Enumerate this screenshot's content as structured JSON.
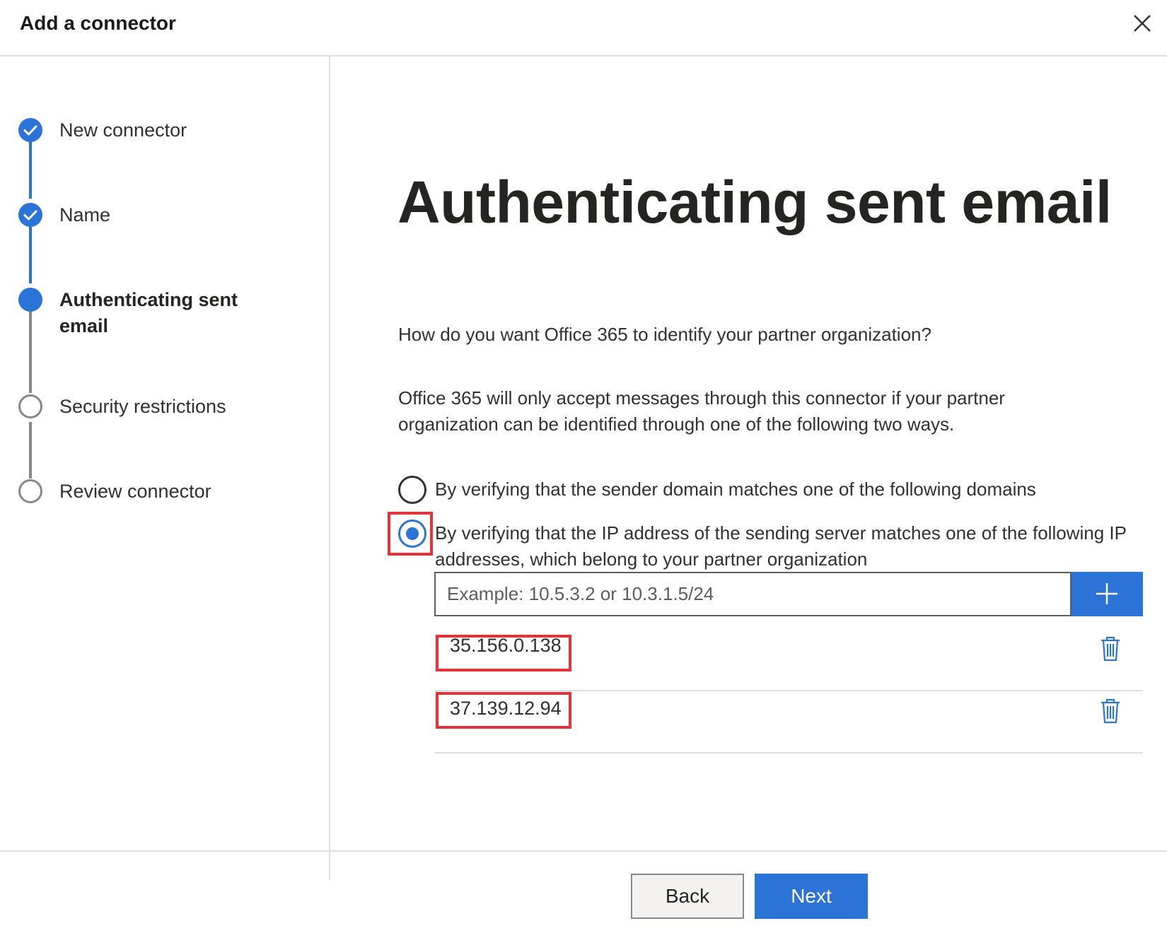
{
  "header": {
    "title": "Add a connector",
    "close_icon": "close-icon"
  },
  "steps": [
    {
      "label": "New connector",
      "state": "completed",
      "icon": "checkmark-icon"
    },
    {
      "label": "Name",
      "state": "completed",
      "icon": "checkmark-icon"
    },
    {
      "label": "Authenticating sent email",
      "state": "current"
    },
    {
      "label": "Security restrictions",
      "state": "pending"
    },
    {
      "label": "Review connector",
      "state": "pending"
    }
  ],
  "main": {
    "title": "Authenticating sent email",
    "question": "How do you want Office 365 to identify your partner organization?",
    "info": "Office 365 will only accept messages through this connector if your partner organization can be identified through one of the following two ways.",
    "options": [
      {
        "label": "By verifying that the sender domain matches one of the following domains",
        "selected": false
      },
      {
        "label": "By verifying that the IP address of the sending server matches one of the following IP addresses, which belong to your partner organization",
        "selected": true
      }
    ],
    "ip_input": {
      "value": "",
      "placeholder": "Example: 10.5.3.2 or 10.3.1.5/24"
    },
    "add_icon": "plus-icon",
    "ip_addresses": [
      "35.156.0.138",
      "37.139.12.94"
    ],
    "delete_icon": "trash-icon"
  },
  "footer": {
    "back_label": "Back",
    "next_label": "Next"
  },
  "colors": {
    "accent": "#2b73d6",
    "highlight": "#e0333a",
    "pending": "#8a8886"
  }
}
